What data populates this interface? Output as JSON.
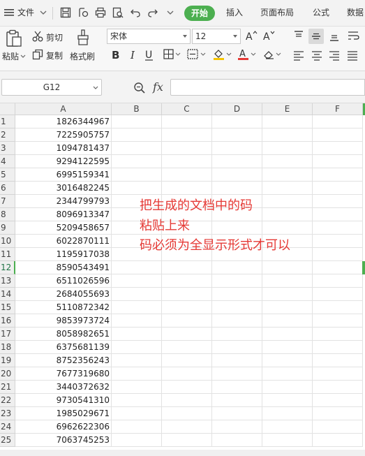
{
  "menu": {
    "file_label": "文件",
    "tabs": [
      "开始",
      "插入",
      "页面布局",
      "公式",
      "数据"
    ]
  },
  "ribbon": {
    "paste_label": "粘贴",
    "cut_label": "剪切",
    "copy_label": "复制",
    "format_painter_label": "格式刷",
    "font_name": "宋体",
    "font_size": "12"
  },
  "formula_bar": {
    "cell_ref": "G12",
    "fx_label": "fx",
    "value": ""
  },
  "sheet": {
    "columns": [
      "A",
      "B",
      "C",
      "D",
      "E",
      "F"
    ],
    "rows": [
      "1",
      "2",
      "3",
      "4",
      "5",
      "6",
      "7",
      "8",
      "9",
      "10",
      "11",
      "12",
      "13",
      "14",
      "15",
      "16",
      "17",
      "18",
      "19",
      "20",
      "21",
      "22",
      "23",
      "24",
      "25"
    ],
    "selected_row": "12",
    "col_a_values": [
      "1826344967",
      "7225905757",
      "1094781437",
      "9294122595",
      "6995159341",
      "3016482245",
      "2344799793",
      "8096913347",
      "5209458657",
      "6022870111",
      "1195917038",
      "8590543491",
      "6511026596",
      "2684055693",
      "5110872342",
      "9853973724",
      "8058982651",
      "6375681139",
      "8752356243",
      "7677319680",
      "3440372632",
      "9730541310",
      "1985029671",
      "6962622306",
      "7063745253"
    ]
  },
  "annotation": {
    "line1": "把生成的文档中的码",
    "line2": "粘贴上来",
    "line3": "码必须为全显示形式才可以",
    "color": "#e53935"
  },
  "colors": {
    "accent": "#4caf50",
    "header_bg": "#efefef"
  }
}
